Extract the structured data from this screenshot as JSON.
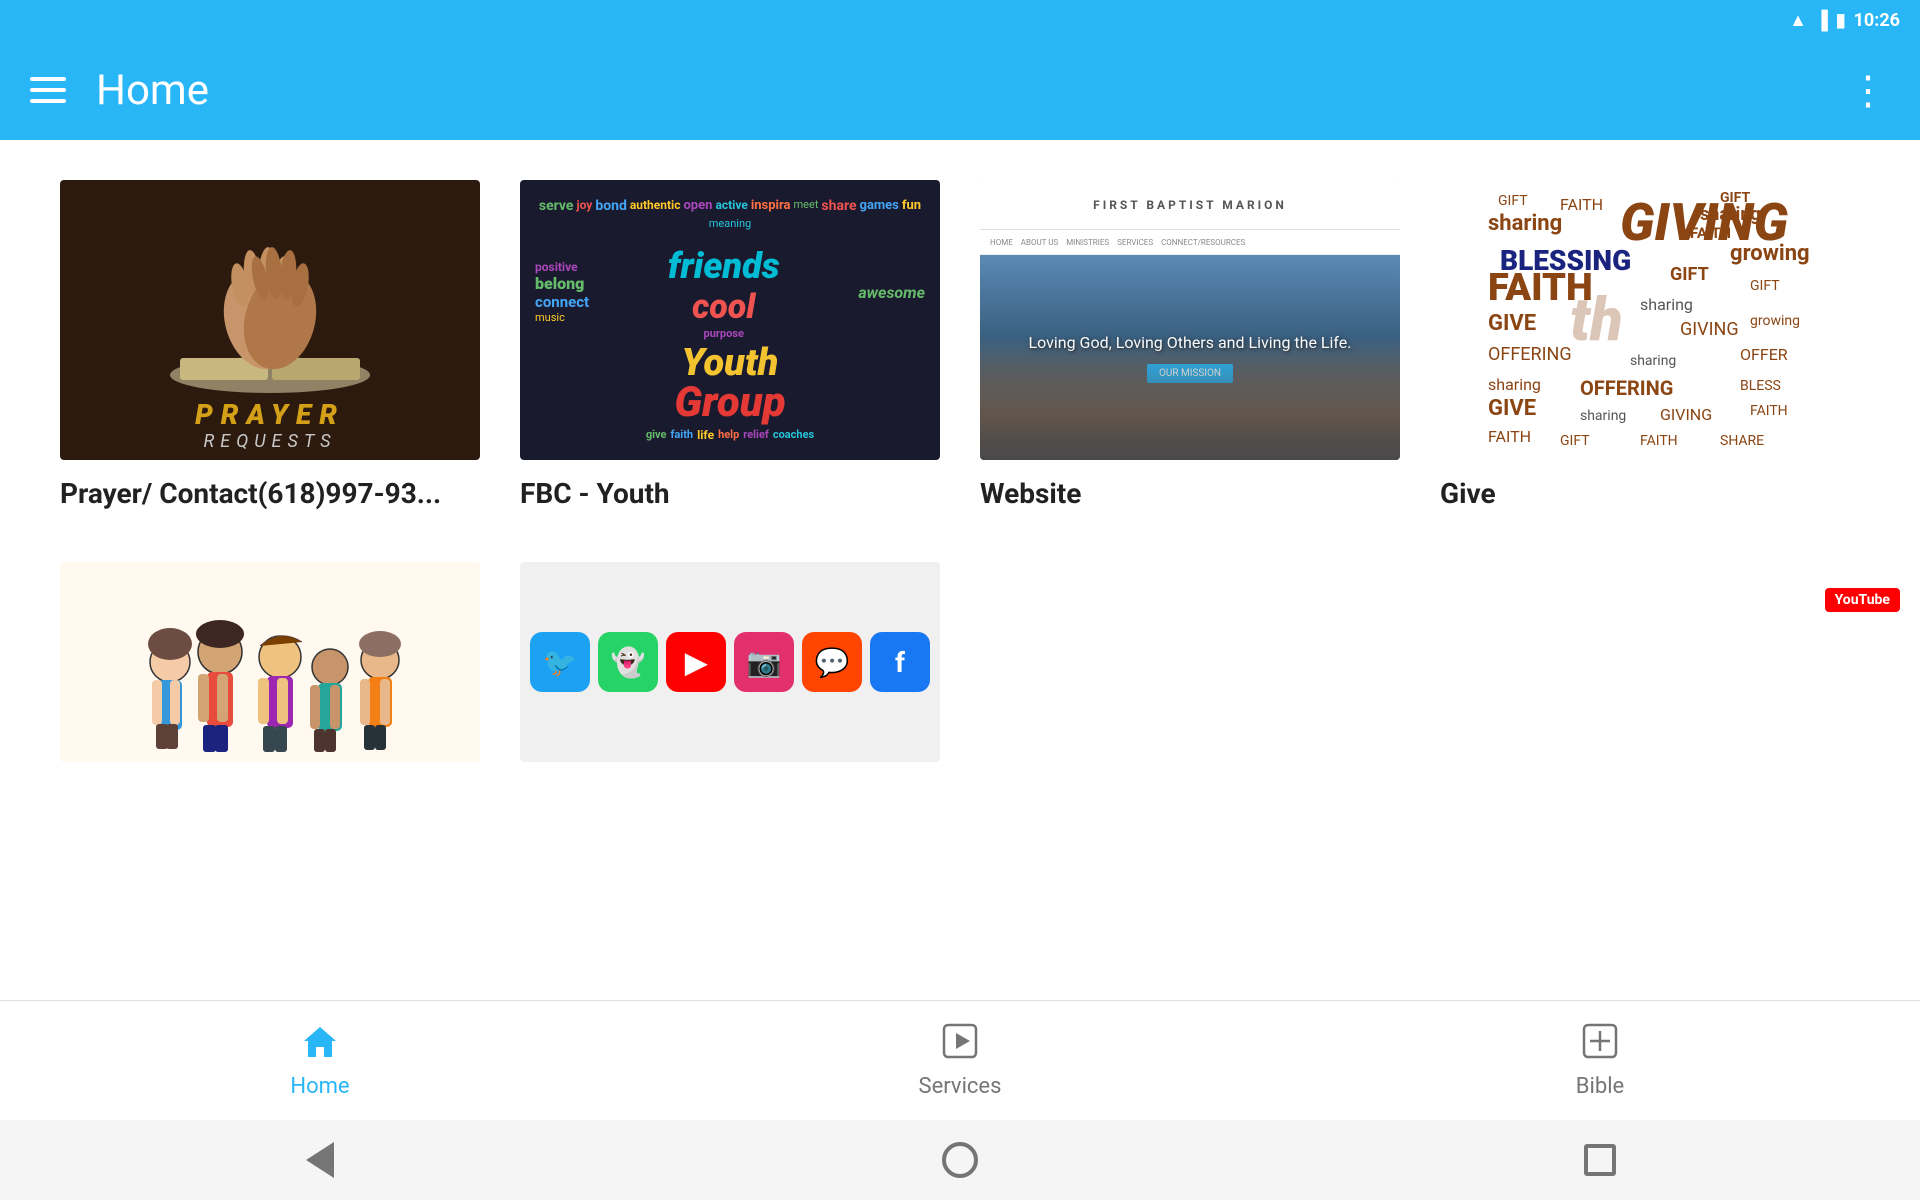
{
  "statusBar": {
    "time": "10:26",
    "icons": [
      "wifi",
      "signal",
      "battery"
    ]
  },
  "appBar": {
    "title": "Home",
    "menuIcon": "hamburger-icon",
    "moreIcon": "more-vertical-icon"
  },
  "cards": [
    {
      "id": "prayer",
      "label": "Prayer/ Contact(618)997-93...",
      "type": "prayer"
    },
    {
      "id": "youth",
      "label": "FBC - Youth",
      "type": "youth"
    },
    {
      "id": "website",
      "label": "Website",
      "type": "website",
      "websiteTitle": "FIRST BAPTIST MARION",
      "heroText": "Loving God, Loving Others and Living the Life.",
      "btnLabel": "OUR MISSION"
    },
    {
      "id": "give",
      "label": "Give",
      "type": "give"
    }
  ],
  "bottomCards": [
    {
      "id": "kids",
      "label": "",
      "type": "kids"
    },
    {
      "id": "social",
      "label": "",
      "type": "social"
    }
  ],
  "navBar": {
    "items": [
      {
        "id": "home",
        "label": "Home",
        "icon": "🏠",
        "active": true
      },
      {
        "id": "services",
        "label": "Services",
        "icon": "▶",
        "active": false
      },
      {
        "id": "bible",
        "label": "Bible",
        "icon": "✛",
        "active": false
      }
    ]
  },
  "sysNav": {
    "back": "back-arrow",
    "home": "home-circle",
    "recents": "recents-square"
  }
}
